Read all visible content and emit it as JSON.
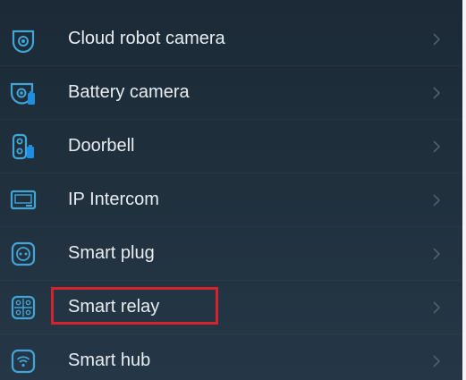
{
  "colors": {
    "background_top": "#1b2a36",
    "background_bottom": "#253747",
    "icon_accent": "#42a5d8",
    "icon_badge": "#1e8ee0",
    "label_text": "#e8edf1",
    "chevron": "#4f5f6c",
    "highlight_border": "#d6222e"
  },
  "device_list": {
    "items": [
      {
        "label": "Cloud robot camera",
        "icon": "cloud-robot-camera-icon"
      },
      {
        "label": "Battery camera",
        "icon": "battery-camera-icon"
      },
      {
        "label": "Doorbell",
        "icon": "doorbell-icon"
      },
      {
        "label": "IP Intercom",
        "icon": "ip-intercom-icon"
      },
      {
        "label": "Smart plug",
        "icon": "smart-plug-icon"
      },
      {
        "label": "Smart relay",
        "icon": "smart-relay-icon",
        "highlighted": true
      },
      {
        "label": "Smart hub",
        "icon": "smart-hub-icon"
      }
    ]
  }
}
